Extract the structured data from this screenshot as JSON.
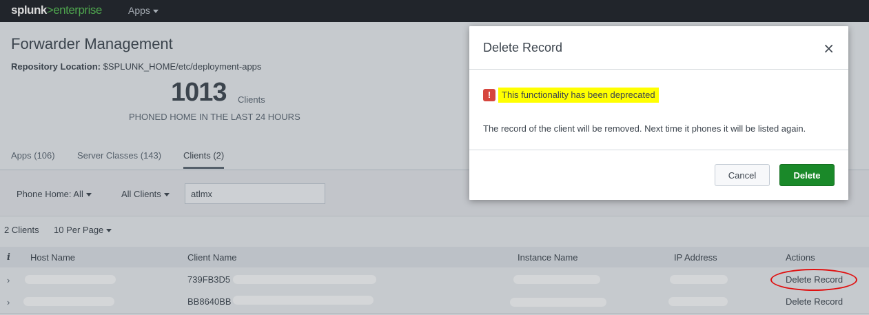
{
  "topbar": {
    "logo_primary": "splunk",
    "logo_secondary": ">enterprise",
    "apps_menu": "Apps"
  },
  "page": {
    "title": "Forwarder Management",
    "repo_label": "Repository Location:",
    "repo_path": "$SPLUNK_HOME/etc/deployment-apps",
    "client_count": "1013",
    "client_unit": "Clients",
    "phoned_home": "PHONED HOME IN THE LAST 24 HOURS"
  },
  "tabs": [
    {
      "label": "Apps (106)"
    },
    {
      "label": "Server Classes (143)"
    },
    {
      "label": "Clients (2)",
      "active": true
    }
  ],
  "filters": {
    "phone_home": "Phone Home: All",
    "clients": "All Clients",
    "search_value": "atlmx"
  },
  "list": {
    "count": "2 Clients",
    "per_page": "10 Per Page"
  },
  "table": {
    "info_icon": "i",
    "columns": [
      "Host Name",
      "Client Name",
      "Instance Name",
      "IP Address",
      "Actions"
    ],
    "rows": [
      {
        "client_name": "739FB3D5",
        "action": "Delete Record"
      },
      {
        "client_name": "BB8640BB",
        "action": "Delete Record"
      }
    ]
  },
  "modal": {
    "title": "Delete Record",
    "close_glyph": "×",
    "alert_icon": "!",
    "alert_text": "This functionality has been deprecated",
    "body": "The record of the client will be removed. Next time it phones it will be listed again.",
    "cancel_label": "Cancel",
    "delete_label": "Delete"
  },
  "colors": {
    "topbar": "#272c33",
    "accent_green": "#1a8929",
    "alert_red": "#d6463e",
    "highlight": "#ffff00",
    "annotation": "#e01010"
  }
}
